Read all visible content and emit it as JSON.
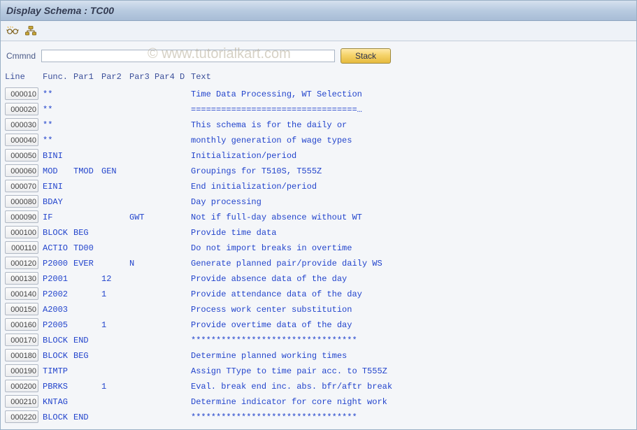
{
  "title": "Display Schema : TC00",
  "watermark": "© www.tutorialkart.com",
  "toolbar": {
    "display_attrs_tooltip": "Display attributes",
    "where_used_tooltip": "Where-used list"
  },
  "cmd": {
    "label": "Cmmnd",
    "value": "",
    "placeholder": "",
    "stack_label": "Stack"
  },
  "headers": {
    "line": "Line",
    "func": "Func.",
    "par1": "Par1",
    "par2": "Par2",
    "par3": "Par3",
    "par4": "Par4",
    "d": "D",
    "text": "Text"
  },
  "rows": [
    {
      "line": "000010",
      "func": "**",
      "par1": "",
      "par2": "",
      "par3": "",
      "par4": "",
      "d": "",
      "text": "Time Data Processing, WT Selection"
    },
    {
      "line": "000020",
      "func": "**",
      "par1": "",
      "par2": "",
      "par3": "",
      "par4": "",
      "d": "",
      "text": "=================================…"
    },
    {
      "line": "000030",
      "func": "**",
      "par1": "",
      "par2": "",
      "par3": "",
      "par4": "",
      "d": "",
      "text": "This schema is for the daily or"
    },
    {
      "line": "000040",
      "func": "**",
      "par1": "",
      "par2": "",
      "par3": "",
      "par4": "",
      "d": "",
      "text": "monthly generation of wage types"
    },
    {
      "line": "000050",
      "func": "BINI",
      "par1": "",
      "par2": "",
      "par3": "",
      "par4": "",
      "d": "",
      "text": "Initialization/period"
    },
    {
      "line": "000060",
      "func": "MOD",
      "par1": "TMOD",
      "par2": "GEN",
      "par3": "",
      "par4": "",
      "d": "",
      "text": "Groupings for T510S, T555Z"
    },
    {
      "line": "000070",
      "func": "EINI",
      "par1": "",
      "par2": "",
      "par3": "",
      "par4": "",
      "d": "",
      "text": "End initialization/period"
    },
    {
      "line": "000080",
      "func": "BDAY",
      "par1": "",
      "par2": "",
      "par3": "",
      "par4": "",
      "d": "",
      "text": "Day processing"
    },
    {
      "line": "000090",
      "func": "IF",
      "par1": "",
      "par2": "",
      "par3": "GWT",
      "par4": "",
      "d": "",
      "text": "Not if full-day absence without WT"
    },
    {
      "line": "000100",
      "func": "BLOCK",
      "par1": "BEG",
      "par2": "",
      "par3": "",
      "par4": "",
      "d": "",
      "text": "Provide time data"
    },
    {
      "line": "000110",
      "func": "ACTIO",
      "par1": "TD00",
      "par2": "",
      "par3": "",
      "par4": "",
      "d": "",
      "text": "Do not import breaks in overtime"
    },
    {
      "line": "000120",
      "func": "P2000",
      "par1": "EVER",
      "par2": "",
      "par3": "N",
      "par4": "",
      "d": "",
      "text": "Generate planned pair/provide daily WS"
    },
    {
      "line": "000130",
      "func": "P2001",
      "par1": "",
      "par2": "12",
      "par3": "",
      "par4": "",
      "d": "",
      "text": "Provide absence data of the day"
    },
    {
      "line": "000140",
      "func": "P2002",
      "par1": "",
      "par2": "1",
      "par3": "",
      "par4": "",
      "d": "",
      "text": "Provide attendance data of the day"
    },
    {
      "line": "000150",
      "func": "A2003",
      "par1": "",
      "par2": "",
      "par3": "",
      "par4": "",
      "d": "",
      "text": "Process work center substitution"
    },
    {
      "line": "000160",
      "func": "P2005",
      "par1": "",
      "par2": "1",
      "par3": "",
      "par4": "",
      "d": "",
      "text": "Provide overtime data of the day"
    },
    {
      "line": "000170",
      "func": "BLOCK",
      "par1": "END",
      "par2": "",
      "par3": "",
      "par4": "",
      "d": "",
      "text": "*********************************"
    },
    {
      "line": "000180",
      "func": "BLOCK",
      "par1": "BEG",
      "par2": "",
      "par3": "",
      "par4": "",
      "d": "",
      "text": "Determine planned working times"
    },
    {
      "line": "000190",
      "func": "TIMTP",
      "par1": "",
      "par2": "",
      "par3": "",
      "par4": "",
      "d": "",
      "text": "Assign TType to time pair acc. to T555Z"
    },
    {
      "line": "000200",
      "func": "PBRKS",
      "par1": "",
      "par2": "1",
      "par3": "",
      "par4": "",
      "d": "",
      "text": "Eval. break end inc. abs. bfr/aftr break"
    },
    {
      "line": "000210",
      "func": "KNTAG",
      "par1": "",
      "par2": "",
      "par3": "",
      "par4": "",
      "d": "",
      "text": "Determine indicator for core night work"
    },
    {
      "line": "000220",
      "func": "BLOCK",
      "par1": "END",
      "par2": "",
      "par3": "",
      "par4": "",
      "d": "",
      "text": "*********************************"
    }
  ]
}
